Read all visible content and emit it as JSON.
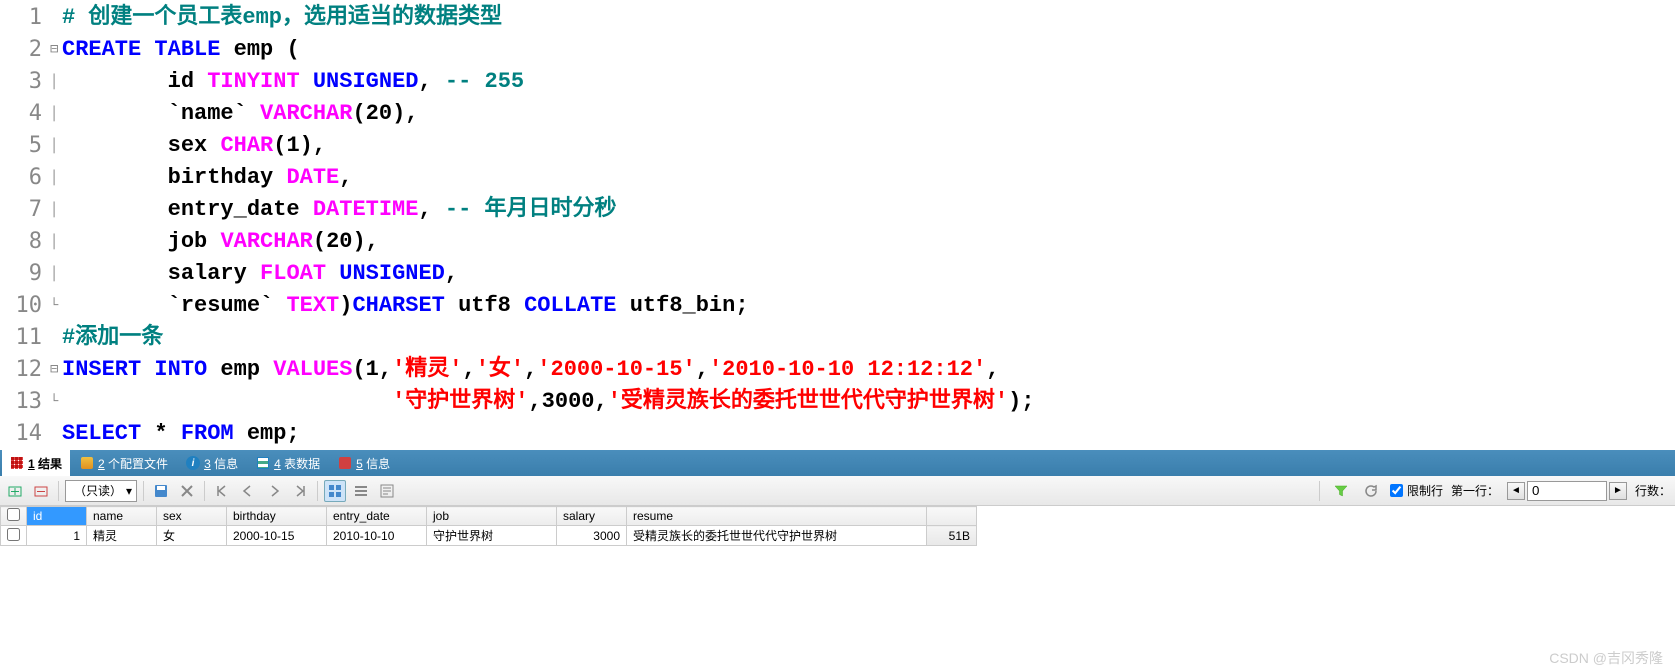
{
  "code": {
    "lines": [
      {
        "n": 1,
        "fold": "",
        "tokens": [
          {
            "t": "# 创建一个员工表emp，选用适当的数据类型",
            "c": "c-comment"
          }
        ]
      },
      {
        "n": 2,
        "fold": "⊟",
        "tokens": [
          {
            "t": "CREATE",
            "c": "c-keyword"
          },
          {
            "t": " ",
            "c": ""
          },
          {
            "t": "TABLE",
            "c": "c-keyword"
          },
          {
            "t": " emp ",
            "c": "c-ident"
          },
          {
            "t": "(",
            "c": "c-paren"
          }
        ]
      },
      {
        "n": 3,
        "fold": "│",
        "tokens": [
          {
            "t": "        id ",
            "c": "c-ident"
          },
          {
            "t": "TINYINT",
            "c": "c-datatype"
          },
          {
            "t": " ",
            "c": ""
          },
          {
            "t": "UNSIGNED",
            "c": "c-keyword"
          },
          {
            "t": ", ",
            "c": "c-punct"
          },
          {
            "t": "-- 255",
            "c": "c-comment"
          }
        ]
      },
      {
        "n": 4,
        "fold": "│",
        "tokens": [
          {
            "t": "        `name` ",
            "c": "c-ident"
          },
          {
            "t": "VARCHAR",
            "c": "c-datatype"
          },
          {
            "t": "(",
            "c": "c-paren"
          },
          {
            "t": "20",
            "c": "c-num"
          },
          {
            "t": ")",
            "c": "c-paren"
          },
          {
            "t": ",",
            "c": "c-punct"
          }
        ]
      },
      {
        "n": 5,
        "fold": "│",
        "tokens": [
          {
            "t": "        sex ",
            "c": "c-ident"
          },
          {
            "t": "CHAR",
            "c": "c-datatype"
          },
          {
            "t": "(",
            "c": "c-paren"
          },
          {
            "t": "1",
            "c": "c-num"
          },
          {
            "t": ")",
            "c": "c-paren"
          },
          {
            "t": ",",
            "c": "c-punct"
          }
        ]
      },
      {
        "n": 6,
        "fold": "│",
        "tokens": [
          {
            "t": "        birthday ",
            "c": "c-ident"
          },
          {
            "t": "DATE",
            "c": "c-datatype"
          },
          {
            "t": ",",
            "c": "c-punct"
          }
        ]
      },
      {
        "n": 7,
        "fold": "│",
        "tokens": [
          {
            "t": "        entry_date ",
            "c": "c-ident"
          },
          {
            "t": "DATETIME",
            "c": "c-datatype"
          },
          {
            "t": ", ",
            "c": "c-punct"
          },
          {
            "t": "-- 年月日时分秒",
            "c": "c-comment"
          }
        ]
      },
      {
        "n": 8,
        "fold": "│",
        "tokens": [
          {
            "t": "        job ",
            "c": "c-ident"
          },
          {
            "t": "VARCHAR",
            "c": "c-datatype"
          },
          {
            "t": "(",
            "c": "c-paren"
          },
          {
            "t": "20",
            "c": "c-num"
          },
          {
            "t": ")",
            "c": "c-paren"
          },
          {
            "t": ",",
            "c": "c-punct"
          }
        ]
      },
      {
        "n": 9,
        "fold": "│",
        "tokens": [
          {
            "t": "        salary ",
            "c": "c-ident"
          },
          {
            "t": "FLOAT",
            "c": "c-datatype"
          },
          {
            "t": " ",
            "c": ""
          },
          {
            "t": "UNSIGNED",
            "c": "c-keyword"
          },
          {
            "t": ",",
            "c": "c-punct"
          }
        ]
      },
      {
        "n": 10,
        "fold": "└",
        "tokens": [
          {
            "t": "        `resume` ",
            "c": "c-ident"
          },
          {
            "t": "TEXT",
            "c": "c-datatype"
          },
          {
            "t": ")",
            "c": "c-paren"
          },
          {
            "t": "CHARSET",
            "c": "c-keyword"
          },
          {
            "t": " utf8 ",
            "c": "c-ident"
          },
          {
            "t": "COLLATE",
            "c": "c-keyword"
          },
          {
            "t": " utf8_bin",
            "c": "c-ident"
          },
          {
            "t": ";",
            "c": "c-punct"
          }
        ]
      },
      {
        "n": 11,
        "fold": "",
        "tokens": [
          {
            "t": "#添加一条",
            "c": "c-comment"
          }
        ]
      },
      {
        "n": 12,
        "fold": "⊟",
        "tokens": [
          {
            "t": "INSERT",
            "c": "c-keyword"
          },
          {
            "t": " ",
            "c": ""
          },
          {
            "t": "INTO",
            "c": "c-keyword"
          },
          {
            "t": " emp ",
            "c": "c-ident"
          },
          {
            "t": "VALUES",
            "c": "c-func"
          },
          {
            "t": "(",
            "c": "c-paren"
          },
          {
            "t": "1",
            "c": "c-num"
          },
          {
            "t": ",",
            "c": "c-punct"
          },
          {
            "t": "'精灵'",
            "c": "c-string"
          },
          {
            "t": ",",
            "c": "c-punct"
          },
          {
            "t": "'女'",
            "c": "c-string"
          },
          {
            "t": ",",
            "c": "c-punct"
          },
          {
            "t": "'2000-10-15'",
            "c": "c-string"
          },
          {
            "t": ",",
            "c": "c-punct"
          },
          {
            "t": "'2010-10-10 12:12:12'",
            "c": "c-string"
          },
          {
            "t": ",",
            "c": "c-punct"
          }
        ]
      },
      {
        "n": 13,
        "fold": "└",
        "tokens": [
          {
            "t": "                         ",
            "c": ""
          },
          {
            "t": "'守护世界树'",
            "c": "c-string"
          },
          {
            "t": ",",
            "c": "c-punct"
          },
          {
            "t": "3000",
            "c": "c-num"
          },
          {
            "t": ",",
            "c": "c-punct"
          },
          {
            "t": "'受精灵族长的委托世世代代守护世界树'",
            "c": "c-string"
          },
          {
            "t": ")",
            "c": "c-paren"
          },
          {
            "t": ";",
            "c": "c-punct"
          }
        ]
      },
      {
        "n": 14,
        "fold": "",
        "tokens": [
          {
            "t": "SELECT",
            "c": "c-keyword"
          },
          {
            "t": " * ",
            "c": "c-punct"
          },
          {
            "t": "FROM",
            "c": "c-keyword"
          },
          {
            "t": " emp",
            "c": "c-ident"
          },
          {
            "t": ";",
            "c": "c-punct"
          }
        ]
      }
    ]
  },
  "tabs": [
    {
      "icon": "grid",
      "label_prefix": "1",
      "label": " 结果",
      "active": true
    },
    {
      "icon": "profile",
      "label_prefix": "2",
      "label": " 个配置文件"
    },
    {
      "icon": "info",
      "label_prefix": "3",
      "label": " 信息"
    },
    {
      "icon": "tabledata",
      "label_prefix": "4",
      "label": " 表数据"
    },
    {
      "icon": "msg",
      "label_prefix": "5",
      "label": " 信息"
    }
  ],
  "toolbar": {
    "readonly_label": "（只读）",
    "limit_label": "限制行",
    "firstrow_label": "第一行：",
    "firstrow_value": "0",
    "rowcount_label": "行数："
  },
  "results": {
    "columns": [
      "id",
      "name",
      "sex",
      "birthday",
      "entry_date",
      "job",
      "salary",
      "resume"
    ],
    "selected_col": 0,
    "rows": [
      {
        "id": "1",
        "name": "精灵",
        "sex": "女",
        "birthday": "2000-10-15",
        "entry_date": "2010-10-10",
        "job": "守护世界树",
        "salary": "3000",
        "resume": "受精灵族长的委托世世代代守护世界树",
        "blob_size": "51B"
      }
    ]
  },
  "watermark": "CSDN @吉冈秀隆"
}
